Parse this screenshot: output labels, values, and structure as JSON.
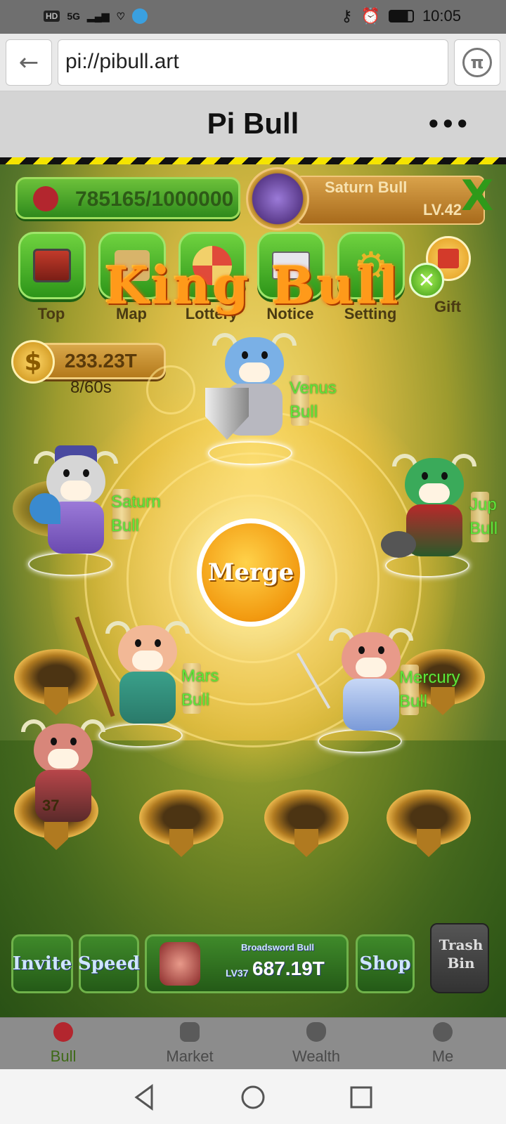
{
  "status_bar": {
    "network": "HD",
    "signal": "5G",
    "time": "10:05"
  },
  "browser": {
    "back_label": "←",
    "url": "pi://pibull.art",
    "pi_icon": "π"
  },
  "page": {
    "title": "Pi Bull",
    "menu": "•••"
  },
  "game": {
    "progress_text": "785165/1000000",
    "progress_fraction": 0.785,
    "profile": {
      "name": "Saturn Bull",
      "level": "LV.42"
    },
    "menu_buttons": [
      {
        "label": "Top",
        "icon": "chest-icon"
      },
      {
        "label": "Map",
        "icon": "map-icon"
      },
      {
        "label": "Lottery",
        "icon": "wheel-icon"
      },
      {
        "label": "Notice",
        "icon": "mail-icon"
      },
      {
        "label": "Setting",
        "icon": "gear-icon"
      },
      {
        "label": "Gift",
        "icon": "gift-icon"
      }
    ],
    "banner": "King Bull",
    "coins": "233.23T",
    "coin_rate": "8/60s",
    "merge_label": "Merge",
    "bulls": {
      "venus": "Venus\nBull",
      "saturn": "Saturn\nBull",
      "jupiter": "Jup\nBull",
      "mars": "Mars\nBull",
      "mercury": "Mercury\nBull"
    },
    "bull_level_badge": "37",
    "bottom": {
      "invite": "Invite",
      "speed": "Speed",
      "buy_name": "Broadsword Bull",
      "buy_level": "LV37",
      "buy_price": "687.19T",
      "shop": "Shop",
      "trash": "Trash\nBin"
    }
  },
  "tabs": [
    {
      "label": "Bull",
      "active": true
    },
    {
      "label": "Market",
      "active": false
    },
    {
      "label": "Wealth",
      "active": false
    },
    {
      "label": "Me",
      "active": false
    }
  ],
  "colors": {
    "active_tab": "#3f6a18",
    "bull_label": "#5fe63a"
  }
}
